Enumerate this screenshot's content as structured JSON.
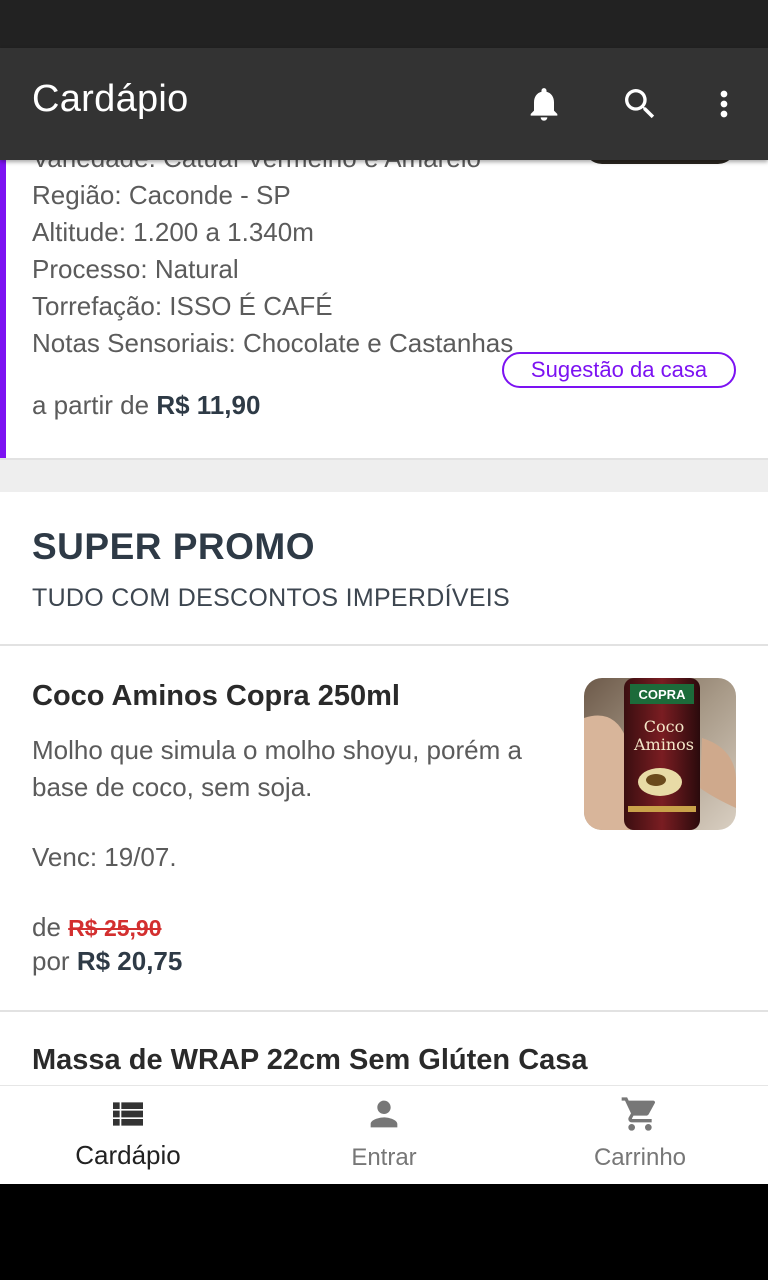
{
  "app_bar": {
    "title": "Cardápio",
    "icons": [
      "bell-icon",
      "search-icon",
      "more-vert-icon"
    ]
  },
  "top_item": {
    "partial_line": "Variedade: Catuaí Vermelho e Amarelo",
    "lines": [
      "Região: Caconde - SP",
      "Altitude: 1.200 a 1.340m",
      "Processo: Natural",
      "Torrefação: ISSO É CAFÉ",
      "Notas Sensoriais: Chocolate e Castanhas"
    ],
    "price_prefix": "a partir de",
    "price": "R$ 11,90",
    "badge": "Sugestão da casa",
    "accent_color": "#7c12f2"
  },
  "section": {
    "title": "SUPER PROMO",
    "subtitle": "TUDO COM DESCONTOS IMPERDÍVEIS"
  },
  "product": {
    "name": "Coco Aminos Copra 250ml",
    "description": "Molho que simula o molho shoyu, porém a base de coco, sem soja.",
    "venc": "Venc: 19/07.",
    "old_price_prefix": "de",
    "old_price": "R$ 25,90",
    "new_price_prefix": "por",
    "new_price": "R$ 20,75",
    "image_label_brand": "COPRA",
    "image_label_line1": "Coco",
    "image_label_line2": "Aminos"
  },
  "next_product": {
    "name": "Massa de WRAP 22cm Sem Glúten Casa"
  },
  "bottom_nav": {
    "items": [
      {
        "label": "Cardápio",
        "icon": "list-icon",
        "active": true
      },
      {
        "label": "Entrar",
        "icon": "person-icon",
        "active": false
      },
      {
        "label": "Carrinho",
        "icon": "cart-icon",
        "active": false
      }
    ]
  }
}
